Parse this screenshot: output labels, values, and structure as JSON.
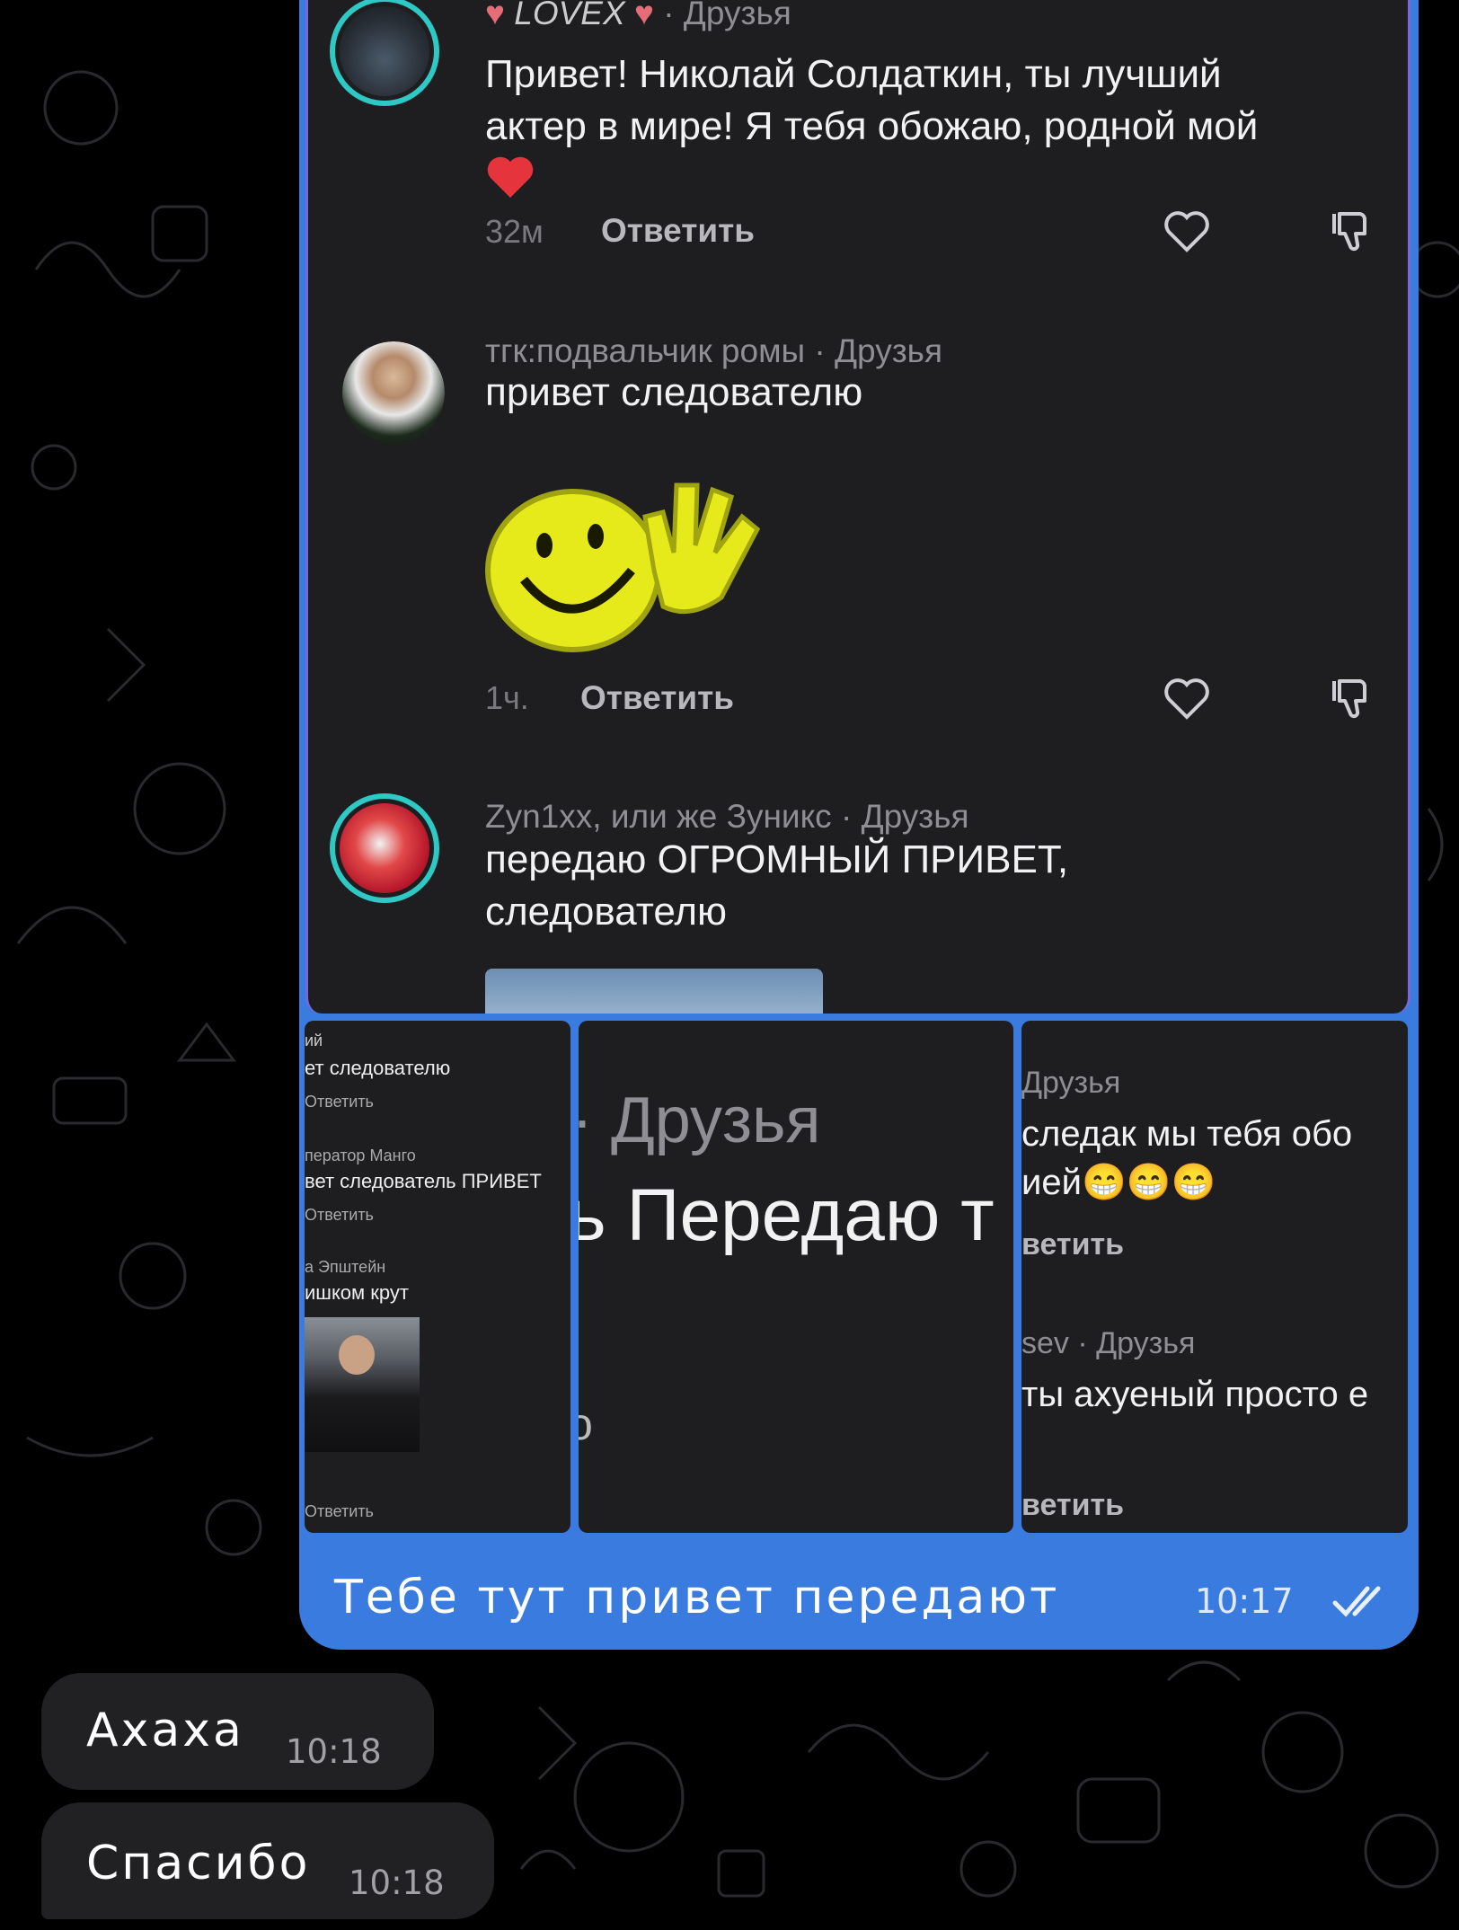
{
  "outgoing": {
    "comments": [
      {
        "author_tag": "LOVEX",
        "author_suffix": "· Друзья",
        "text_lines": [
          "Привет! Николай Солдаткин, ты лучший",
          "актер в мире! Я тебя обожаю, родной мой"
        ],
        "emoji": "❤️",
        "time": "32м",
        "reply": "Ответить"
      },
      {
        "author": "тгк:подвальчик ромы · Друзья",
        "text_lines": [
          "привет следователю"
        ],
        "time": "1ч.",
        "reply": "Ответить"
      },
      {
        "author": "Zyn1xx, или же Зуникс · Друзья",
        "text_lines": [
          "передаю ОГРОМНЫЙ ПРИВЕТ,",
          "следователю"
        ]
      }
    ],
    "thumb1": {
      "lines": [
        "ий",
        "ет следователю",
        "Ответить",
        "ператор Манго",
        "вет следователь ПРИВЕТ",
        "Ответить",
        "а Эпштейн",
        "ишком крут",
        "Ответить"
      ]
    },
    "thumb2": {
      "lines": [
        "· Друзья",
        "ь Передаю т",
        "о"
      ]
    },
    "thumb3": {
      "lines": [
        "Друзья",
        "следак мы тебя обо",
        "ией",
        "ветить",
        "sev · Друзья",
        "ты ахуеный просто е",
        "ветить"
      ],
      "emoji": "😁😁😁"
    },
    "caption": "Тебе тут привет передают",
    "time": "10:17"
  },
  "incoming": [
    {
      "text": "Ахаха",
      "time": "10:18"
    },
    {
      "text": "Спасибо",
      "time": "10:18"
    }
  ],
  "colors": {
    "accent_bubble": "#3a7be0",
    "avatar_ring": "#2ec8c5",
    "heart": "#e5343b",
    "dark_panel": "#1e1e21"
  }
}
